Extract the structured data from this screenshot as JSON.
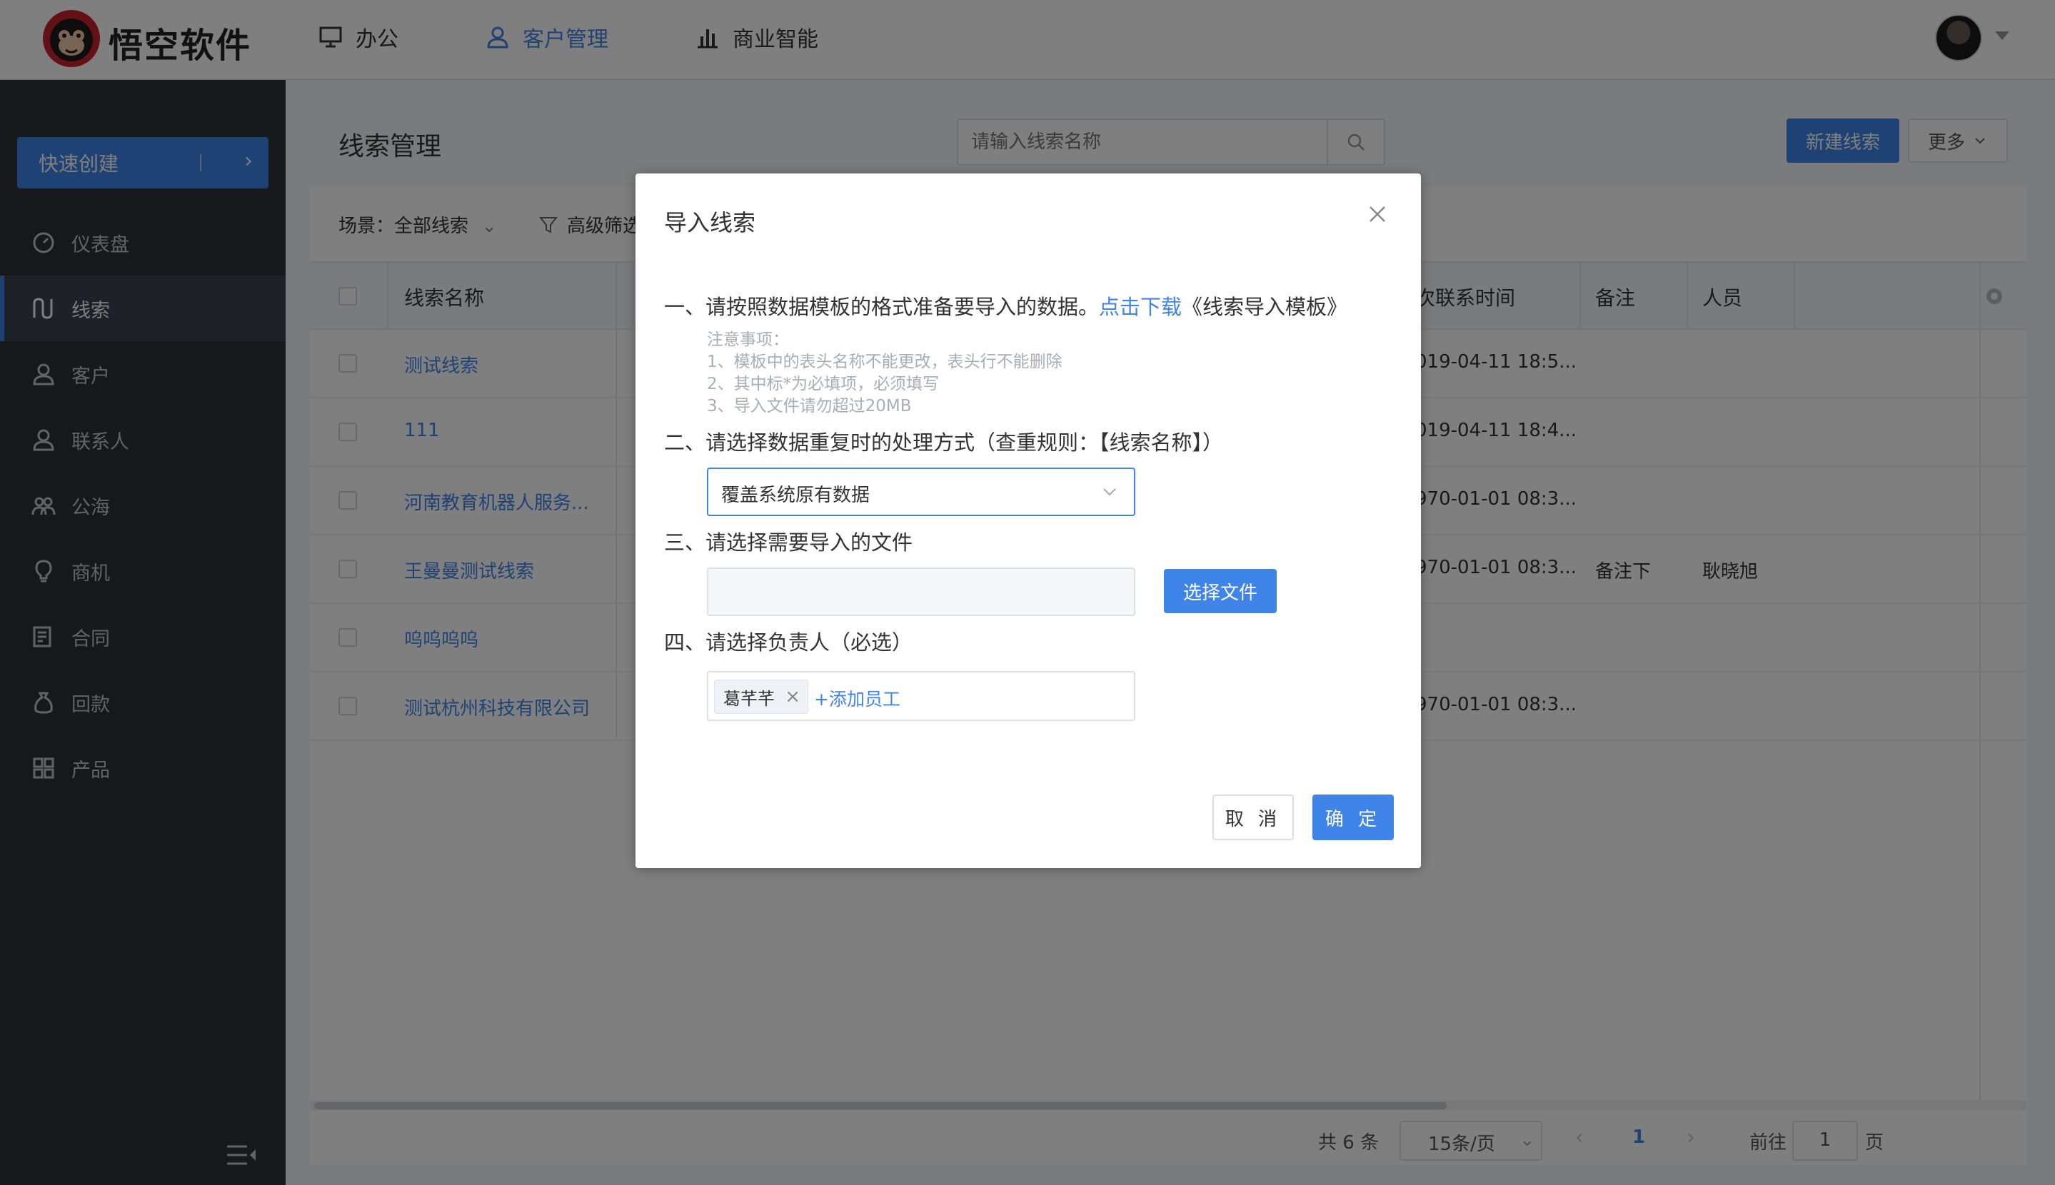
{
  "header": {
    "brand": "悟空软件",
    "nav": [
      {
        "label": "办公",
        "icon": "monitor-icon"
      },
      {
        "label": "客户管理",
        "icon": "user-icon"
      },
      {
        "label": "商业智能",
        "icon": "bar-chart-icon"
      }
    ],
    "active_nav": "客户管理"
  },
  "sidebar": {
    "quick_create": "快速创建",
    "items": [
      {
        "label": "仪表盘",
        "icon": "dashboard-icon"
      },
      {
        "label": "线索",
        "icon": "leads-icon"
      },
      {
        "label": "客户",
        "icon": "customer-icon"
      },
      {
        "label": "联系人",
        "icon": "contact-icon"
      },
      {
        "label": "公海",
        "icon": "group-icon"
      },
      {
        "label": "商机",
        "icon": "bulb-icon"
      },
      {
        "label": "合同",
        "icon": "contract-icon"
      },
      {
        "label": "回款",
        "icon": "payment-icon"
      },
      {
        "label": "产品",
        "icon": "product-icon"
      }
    ],
    "active_item": "线索"
  },
  "main": {
    "title": "线索管理",
    "search_placeholder": "请输入线索名称",
    "new_button": "新建线索",
    "more_button": "更多",
    "scene_label": "场景：全部线索",
    "advanced_filter": "高级筛选",
    "table": {
      "columns": [
        "线索名称",
        "次联系时间",
        "备注",
        "人员"
      ],
      "rows": [
        {
          "name": "测试线索",
          "time": "019-04-11 18:5...",
          "note": "",
          "person": ""
        },
        {
          "name": "111",
          "time": "019-04-11 18:4...",
          "note": "",
          "person": ""
        },
        {
          "name": "河南教育机器人服务...",
          "time": "970-01-01 08:3...",
          "note": "",
          "person": ""
        },
        {
          "name": "王曼曼测试线索",
          "time": "970-01-01 08:3...",
          "note": "备注下",
          "person": "耿晓旭"
        },
        {
          "name": "呜呜呜呜",
          "time": "",
          "note": "",
          "person": ""
        },
        {
          "name": "测试杭州科技有限公司",
          "time": "970-01-01 08:3...",
          "note": "",
          "person": ""
        }
      ]
    },
    "pagination": {
      "total": "共 6 条",
      "page_size": "15条/页",
      "current_page": "1",
      "goto_label": "前往",
      "goto_value": "1",
      "page_suffix": "页"
    }
  },
  "dialog": {
    "title": "导入线索",
    "step1_text": "一、请按照数据模板的格式准备要导入的数据。",
    "step1_link": "点击下载",
    "step1_template": "《线索导入模板》",
    "notes": [
      "注意事项：",
      "1、模板中的表头名称不能更改，表头行不能删除",
      "2、其中标*为必填项，必须填写",
      "3、导入文件请勿超过20MB"
    ],
    "step2_text": "二、请选择数据重复时的处理方式（查重规则：【线索名称】）",
    "duplicate_option": "覆盖系统原有数据",
    "step3_text": "三、请选择需要导入的文件",
    "choose_file_button": "选择文件",
    "step4_text": "四、请选择负责人（必选）",
    "owner_tag": "葛芊芊",
    "add_employee": "+添加员工",
    "cancel_button": "取 消",
    "ok_button": "确 定"
  },
  "colors": {
    "accent": "#3e84e9",
    "sidebar_bg": "#2d3037",
    "overlay": "rgba(0,0,0,0.5)"
  }
}
